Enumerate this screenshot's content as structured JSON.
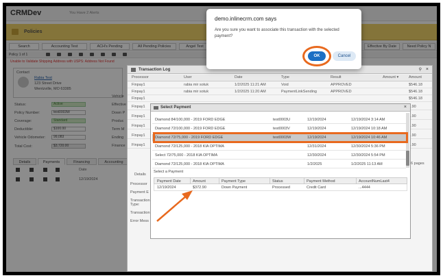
{
  "app": {
    "brand": "CRMDev",
    "notification": "You Have 2 Alerts"
  },
  "page": {
    "title": "Policies"
  },
  "tabs": [
    "Search",
    "Accounting Test",
    "ACH's Pending",
    "All Pending Policies",
    "Angel Test",
    "Effective By Date",
    "Need Policy N"
  ],
  "toolbar": {
    "policy_of": "Policy 1 of 1"
  },
  "warning": "Unable to Validate Shipping Address with USPS: Address Not Found",
  "contact": {
    "label": "Contact",
    "name": "Rabia Test",
    "street": "123 Street Drive",
    "city": "Wentzville, MO 63385"
  },
  "fields": [
    {
      "label": "Status:",
      "value": "Active"
    },
    {
      "label": "Policy Number:",
      "value": "test0003W"
    },
    {
      "label": "Coverage:",
      "value": "Standard"
    },
    {
      "label": "Deductible:",
      "value": "$100.00"
    },
    {
      "label": "Vehicle Odometer:",
      "value": "99,083"
    },
    {
      "label": "Total Cost:",
      "value": "$3,720.00"
    }
  ],
  "right_labels": [
    "Vehicle",
    "Effective",
    "Down P",
    "Produc",
    "Term M",
    "Ending",
    "Finance"
  ],
  "subtabs": [
    "Details",
    "Payments",
    "Financing",
    "Accounting"
  ],
  "payment_row_date": "12/19/2024",
  "date_col": "Date",
  "payment_detail_labels": [
    "Details",
    "Processor",
    "Payment E",
    "Transaction Type:",
    "Transaction",
    "Error Mess"
  ],
  "txlog": {
    "title": "Transaction Log",
    "headers": [
      "Processor",
      "User",
      "Date",
      "Type",
      "Result",
      "Amount ▾",
      "Amount"
    ],
    "rows": [
      {
        "processor": "Finpay1",
        "user": "rabia mir sotuk",
        "date": "1/2/2025 11:21 AM",
        "type": "Void",
        "result": "APPROVED",
        "amount": "$546.18"
      },
      {
        "processor": "Finpay1",
        "user": "rabia mir sotuk",
        "date": "1/2/2025 11:20 AM",
        "type": "PaymentLinkSending",
        "result": "APPROVED",
        "amount": "$546.18"
      },
      {
        "processor": "Finpay1",
        "user": "",
        "date": "",
        "type": "",
        "result": "",
        "amount": "$546.18"
      },
      {
        "processor": "Finpay1",
        "user": "",
        "date": "",
        "type": "",
        "result": "",
        "amount": "2.90"
      },
      {
        "processor": "Finpay1",
        "user": "",
        "date": "",
        "type": "",
        "result": "",
        "amount": "2.90"
      },
      {
        "processor": "Finpay1",
        "user": "",
        "date": "",
        "type": "",
        "result": "",
        "amount": "2.90"
      },
      {
        "processor": "Finpay1",
        "user": "",
        "date": "",
        "type": "",
        "result": "",
        "amount": "2.90"
      },
      {
        "processor": "Finpay1",
        "user": "",
        "date": "",
        "type": "",
        "result": "",
        "amount": "2.90"
      }
    ],
    "pages": "16 pages"
  },
  "select_payment": {
    "title": "Select Payment",
    "rows": [
      {
        "plan": "Diamond 84/100,000 - 2019 FORD EDGE",
        "policy": "test0003U",
        "date": "12/19/2024",
        "datetime": "12/19/2024 3:14 AM"
      },
      {
        "plan": "Diamond 72/100,000 - 2019 FORD EDGE",
        "policy": "test0003V",
        "date": "12/19/2024",
        "datetime": "12/19/2024 10:18 AM"
      },
      {
        "plan": "Diamond 72/75,000 - 2019 FORD EDGE",
        "policy": "test0003W",
        "date": "12/19/2024",
        "datetime": "12/19/2024 10:46 AM"
      },
      {
        "plan": "Diamond 72/125,000 - 2018 KIA OPTIMA",
        "policy": "",
        "date": "12/31/2024",
        "datetime": "12/30/2024 5:36 PM"
      },
      {
        "plan": "Select 72/75,000 - 2018 KIA OPTIMA",
        "policy": "",
        "date": "12/30/2024",
        "datetime": "12/30/2024 5:54 PM"
      },
      {
        "plan": "Diamond 72/125,000 - 2018 KIA OPTIMA",
        "policy": "",
        "date": "1/2/2025",
        "datetime": "1/2/2025 11:13 AM"
      }
    ],
    "selected_index": 2,
    "label": "Select a Payment",
    "headers": [
      "Payment Date",
      "Amount",
      "Payment Type",
      "Status",
      "Payment Method",
      "AccountNumLast4"
    ],
    "payment": {
      "date": "12/19/2024",
      "amount": "$372.90",
      "type": "Down Payment",
      "status": "Processed",
      "method": "Credit Card",
      "last4": "...4444"
    }
  },
  "dialog": {
    "title": "demo.inlinecrm.com says",
    "message": "Are you sure you want to associate this transaction with the selected payment?",
    "ok": "OK",
    "cancel": "Cancel"
  },
  "colors": {
    "accent": "#1b6fc4",
    "highlight": "#e8691e",
    "page_header": "#f1d36a"
  }
}
